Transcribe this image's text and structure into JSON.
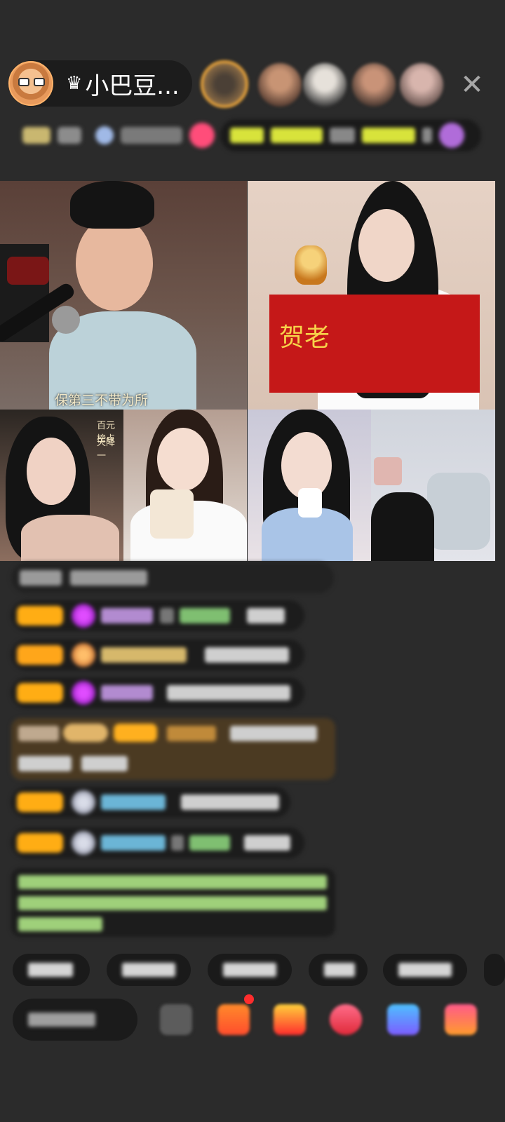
{
  "header": {
    "host_name": "小巴豆...",
    "crown_icon": "crown-icon",
    "close_icon": "close-icon"
  },
  "video": {
    "tile1_caption": "保第三不带为所",
    "tile2_banner_text": "贺老",
    "tile3_text_line1": "百元榜点",
    "tile3_text_line2": "天降一"
  },
  "colors": {
    "badge": "#ffad14",
    "gift_row_bg": "#4b3a22",
    "notice_text": "#9fd07a",
    "page_bg": "#2b2b2b"
  }
}
